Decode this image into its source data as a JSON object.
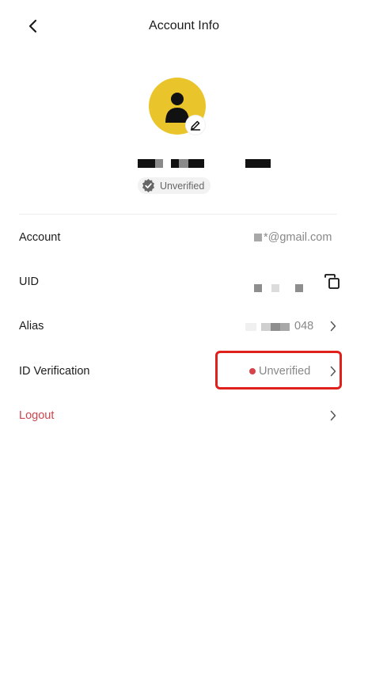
{
  "header": {
    "title": "Account Info"
  },
  "profile": {
    "verification_status": "Unverified"
  },
  "rows": [
    {
      "label": "Account",
      "value": "*@gmail.com"
    },
    {
      "label": "UID",
      "value": ""
    },
    {
      "label": "Alias",
      "value": "048"
    },
    {
      "label": "ID Verification",
      "value": "Unverified"
    },
    {
      "label": "Logout",
      "value": ""
    }
  ],
  "colors": {
    "avatar_bg": "#e9c42a",
    "logout_text": "#d0454f",
    "status_dot": "#d7424a",
    "highlight": "#e0201b"
  }
}
